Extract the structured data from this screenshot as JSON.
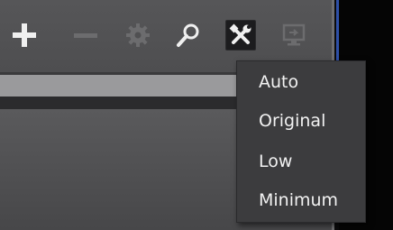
{
  "toolbar": {
    "buttons": [
      {
        "icon": "plus-icon",
        "enabled": true
      },
      {
        "icon": "minus-icon",
        "enabled": false
      },
      {
        "icon": "gear-icon",
        "enabled": false
      },
      {
        "icon": "search-icon",
        "enabled": true
      },
      {
        "icon": "tools-icon",
        "enabled": true,
        "active": true
      },
      {
        "icon": "display-icon",
        "enabled": false
      }
    ]
  },
  "quality_menu": {
    "items": [
      {
        "label": "Auto"
      },
      {
        "label": "Original"
      },
      {
        "label": "Low"
      },
      {
        "label": "Minimum"
      }
    ]
  },
  "colors": {
    "panel": "#4c4c4e",
    "menu_background": "#3c3c3e",
    "menu_text": "#f2f2f2",
    "icon_enabled": "#f0f0f0",
    "icon_disabled": "#6c6c6e",
    "accent_frame": "#2f50a8"
  }
}
